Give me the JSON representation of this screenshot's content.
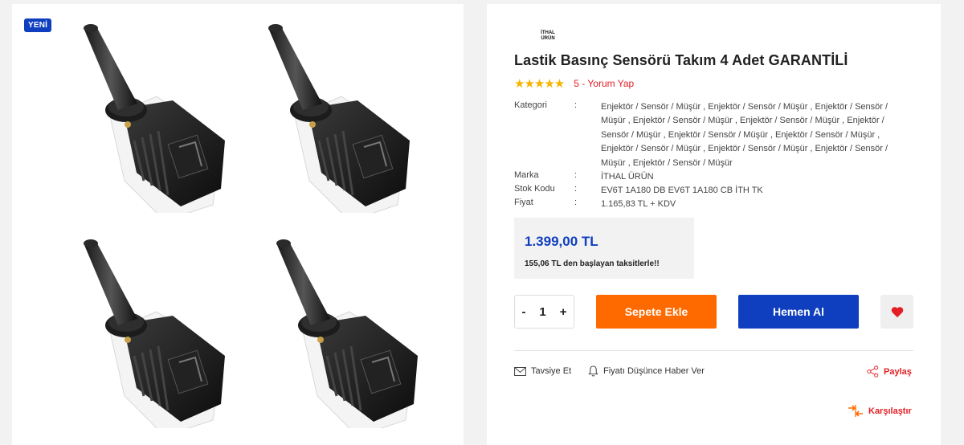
{
  "gallery": {
    "badge": "YENİ"
  },
  "product": {
    "brand_logo_line1": "İTHAL",
    "brand_logo_line2": "ÜRÜN",
    "title": "Lastik Basınç Sensörü Takım 4 Adet GARANTİLİ",
    "rating": 5,
    "stars": "★★★★★",
    "review_link": "5 - Yorum Yap",
    "specs": {
      "category_label": "Kategori",
      "category_value": "Enjektör / Sensör / Müşür , Enjektör / Sensör / Müşür , Enjektör / Sensör / Müşür , Enjektör / Sensör / Müşür , Enjektör / Sensör / Müşür , Enjektör / Sensör / Müşür , Enjektör / Sensör / Müşür , Enjektör / Sensör / Müşür , Enjektör / Sensör / Müşür , Enjektör / Sensör / Müşür , Enjektör / Sensör / Müşür , Enjektör / Sensör / Müşür",
      "brand_label": "Marka",
      "brand_value": "İTHAL ÜRÜN",
      "code_label": "Stok Kodu",
      "code_value": "EV6T 1A180 DB EV6T 1A180 CB İTH TK",
      "price_label": "Fiyat",
      "price_value": "1.165,83 TL + KDV",
      "separator": ":"
    },
    "price": "1.399,00 TL",
    "installment": "155,06 TL den başlayan taksitlerle!!",
    "quantity": "1",
    "minus": "-",
    "plus": "+"
  },
  "actions": {
    "add_to_cart": "Sepete Ekle",
    "buy_now": "Hemen Al",
    "favorite_icon": "heart-icon",
    "recommend": "Tavsiye Et",
    "price_alert": "Fiyatı Düşünce Haber Ver",
    "share": "Paylaş",
    "compare": "Karşılaştır"
  },
  "colors": {
    "brand_blue": "#0f3fbf",
    "orange": "#ff6a00",
    "red": "#e31e24",
    "star": "#f6b400"
  }
}
